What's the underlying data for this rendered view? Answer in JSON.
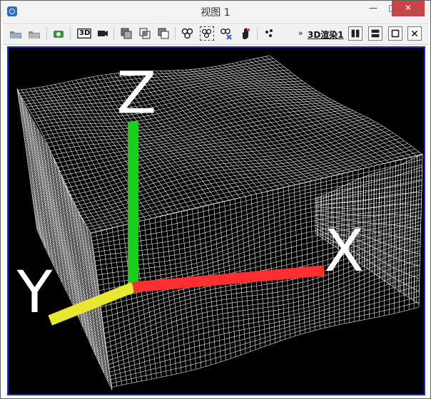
{
  "window": {
    "title": "视图 1"
  },
  "toolbar": {
    "three_d_button_label": "3D",
    "more_indicator": "»",
    "render_label": "3D渲染1"
  },
  "window_controls": {
    "minimize": "—",
    "maximize": "□",
    "close": "✕"
  },
  "viewport": {
    "axis_labels": [
      "X",
      "Y",
      "Z"
    ],
    "accent": "#1f28c8"
  }
}
